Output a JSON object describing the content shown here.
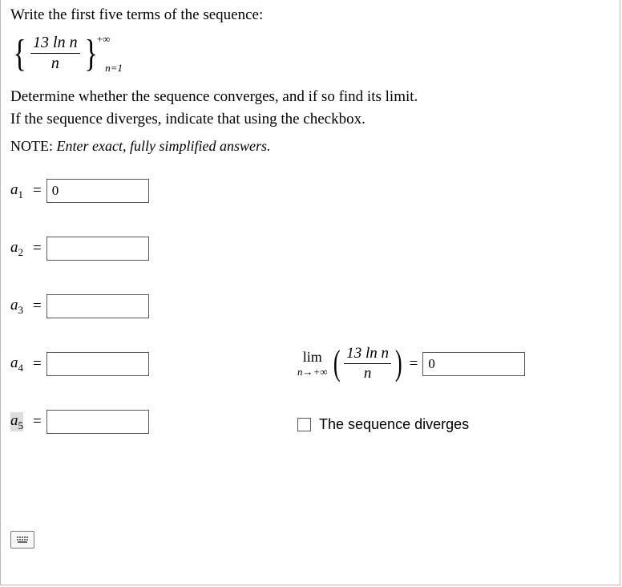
{
  "question": {
    "prompt": "Write the first five terms of the sequence:",
    "sequence_numerator": "13 ln n",
    "sequence_denominator": "n",
    "upper_limit": "+∞",
    "lower_limit": "n=1",
    "instruction_line1": "Determine whether the sequence converges, and if so find its limit.",
    "instruction_line2": "If the sequence diverges, indicate that using the checkbox.",
    "note_label": "NOTE:",
    "note_text": " Enter exact, fully simplified answers."
  },
  "terms": {
    "a1": {
      "label_var": "a",
      "label_sub": "1",
      "value": "0"
    },
    "a2": {
      "label_var": "a",
      "label_sub": "2",
      "value": ""
    },
    "a3": {
      "label_var": "a",
      "label_sub": "3",
      "value": ""
    },
    "a4": {
      "label_var": "a",
      "label_sub": "4",
      "value": ""
    },
    "a5": {
      "label_var": "a",
      "label_sub": "5",
      "value": ""
    }
  },
  "limit": {
    "lim_text": "lim",
    "lim_sub": "n→+∞",
    "frac_num": "13 ln n",
    "frac_den": "n",
    "equals": "=",
    "value": "0"
  },
  "diverge": {
    "label": "The sequence diverges",
    "checked": false
  },
  "symbols": {
    "equals": "="
  }
}
